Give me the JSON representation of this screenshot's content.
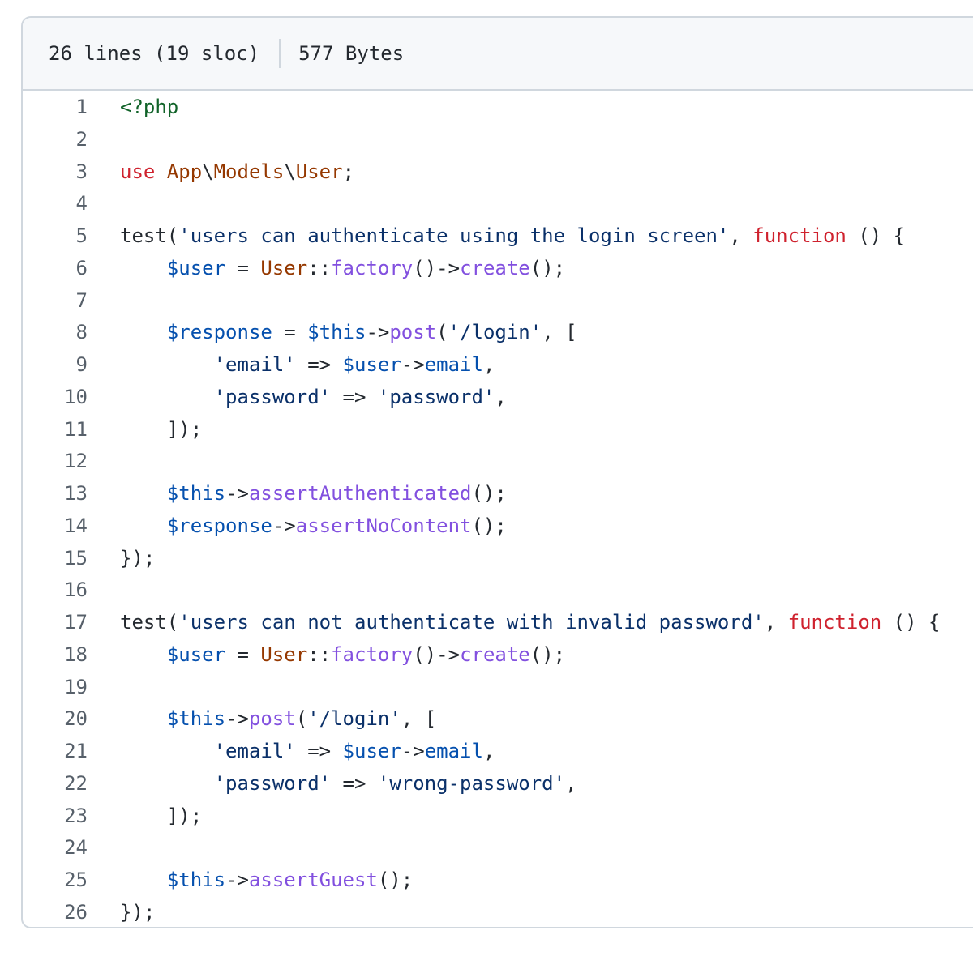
{
  "file_info": {
    "lines": "26 lines (19 sloc)",
    "size": "577 Bytes"
  },
  "colors": {
    "preprocessor": "#116329",
    "keyword": "#cf222e",
    "class": "#953800",
    "string": "#0a3069",
    "variable": "#0550ae",
    "function": "#8250df",
    "plain": "#24292f",
    "line_number": "#57606a"
  },
  "code_lines": [
    {
      "num": "1",
      "tokens": [
        [
          "prep",
          "<?php"
        ]
      ]
    },
    {
      "num": "2",
      "tokens": []
    },
    {
      "num": "3",
      "tokens": [
        [
          "kw",
          "use "
        ],
        [
          "class",
          "App"
        ],
        [
          "plain",
          "\\"
        ],
        [
          "class",
          "Models"
        ],
        [
          "plain",
          "\\"
        ],
        [
          "class",
          "User"
        ],
        [
          "plain",
          ";"
        ]
      ]
    },
    {
      "num": "4",
      "tokens": []
    },
    {
      "num": "5",
      "tokens": [
        [
          "plain",
          "test("
        ],
        [
          "str",
          "'users can authenticate using the login screen'"
        ],
        [
          "plain",
          ", "
        ],
        [
          "kw",
          "function"
        ],
        [
          "plain",
          " () {"
        ]
      ]
    },
    {
      "num": "6",
      "tokens": [
        [
          "plain",
          "    "
        ],
        [
          "var",
          "$user"
        ],
        [
          "plain",
          " = "
        ],
        [
          "class",
          "User"
        ],
        [
          "plain",
          "::"
        ],
        [
          "fn",
          "factory"
        ],
        [
          "plain",
          "()->"
        ],
        [
          "fn",
          "create"
        ],
        [
          "plain",
          "();"
        ]
      ]
    },
    {
      "num": "7",
      "tokens": []
    },
    {
      "num": "8",
      "tokens": [
        [
          "plain",
          "    "
        ],
        [
          "var",
          "$response"
        ],
        [
          "plain",
          " = "
        ],
        [
          "var",
          "$this"
        ],
        [
          "plain",
          "->"
        ],
        [
          "fn",
          "post"
        ],
        [
          "plain",
          "("
        ],
        [
          "str",
          "'/login'"
        ],
        [
          "plain",
          ", ["
        ]
      ]
    },
    {
      "num": "9",
      "tokens": [
        [
          "plain",
          "        "
        ],
        [
          "str",
          "'email'"
        ],
        [
          "plain",
          " => "
        ],
        [
          "var",
          "$user"
        ],
        [
          "plain",
          "->"
        ],
        [
          "prop",
          "email"
        ],
        [
          "plain",
          ","
        ]
      ]
    },
    {
      "num": "10",
      "tokens": [
        [
          "plain",
          "        "
        ],
        [
          "str",
          "'password'"
        ],
        [
          "plain",
          " => "
        ],
        [
          "str",
          "'password'"
        ],
        [
          "plain",
          ","
        ]
      ]
    },
    {
      "num": "11",
      "tokens": [
        [
          "plain",
          "    ]);"
        ]
      ]
    },
    {
      "num": "12",
      "tokens": []
    },
    {
      "num": "13",
      "tokens": [
        [
          "plain",
          "    "
        ],
        [
          "var",
          "$this"
        ],
        [
          "plain",
          "->"
        ],
        [
          "fn",
          "assertAuthenticated"
        ],
        [
          "plain",
          "();"
        ]
      ]
    },
    {
      "num": "14",
      "tokens": [
        [
          "plain",
          "    "
        ],
        [
          "var",
          "$response"
        ],
        [
          "plain",
          "->"
        ],
        [
          "fn",
          "assertNoContent"
        ],
        [
          "plain",
          "();"
        ]
      ]
    },
    {
      "num": "15",
      "tokens": [
        [
          "plain",
          "});"
        ]
      ]
    },
    {
      "num": "16",
      "tokens": []
    },
    {
      "num": "17",
      "tokens": [
        [
          "plain",
          "test("
        ],
        [
          "str",
          "'users can not authenticate with invalid password'"
        ],
        [
          "plain",
          ", "
        ],
        [
          "kw",
          "function"
        ],
        [
          "plain",
          " () {"
        ]
      ]
    },
    {
      "num": "18",
      "tokens": [
        [
          "plain",
          "    "
        ],
        [
          "var",
          "$user"
        ],
        [
          "plain",
          " = "
        ],
        [
          "class",
          "User"
        ],
        [
          "plain",
          "::"
        ],
        [
          "fn",
          "factory"
        ],
        [
          "plain",
          "()->"
        ],
        [
          "fn",
          "create"
        ],
        [
          "plain",
          "();"
        ]
      ]
    },
    {
      "num": "19",
      "tokens": []
    },
    {
      "num": "20",
      "tokens": [
        [
          "plain",
          "    "
        ],
        [
          "var",
          "$this"
        ],
        [
          "plain",
          "->"
        ],
        [
          "fn",
          "post"
        ],
        [
          "plain",
          "("
        ],
        [
          "str",
          "'/login'"
        ],
        [
          "plain",
          ", ["
        ]
      ]
    },
    {
      "num": "21",
      "tokens": [
        [
          "plain",
          "        "
        ],
        [
          "str",
          "'email'"
        ],
        [
          "plain",
          " => "
        ],
        [
          "var",
          "$user"
        ],
        [
          "plain",
          "->"
        ],
        [
          "prop",
          "email"
        ],
        [
          "plain",
          ","
        ]
      ]
    },
    {
      "num": "22",
      "tokens": [
        [
          "plain",
          "        "
        ],
        [
          "str",
          "'password'"
        ],
        [
          "plain",
          " => "
        ],
        [
          "str",
          "'wrong-password'"
        ],
        [
          "plain",
          ","
        ]
      ]
    },
    {
      "num": "23",
      "tokens": [
        [
          "plain",
          "    ]);"
        ]
      ]
    },
    {
      "num": "24",
      "tokens": []
    },
    {
      "num": "25",
      "tokens": [
        [
          "plain",
          "    "
        ],
        [
          "var",
          "$this"
        ],
        [
          "plain",
          "->"
        ],
        [
          "fn",
          "assertGuest"
        ],
        [
          "plain",
          "();"
        ]
      ]
    },
    {
      "num": "26",
      "tokens": [
        [
          "plain",
          "});"
        ]
      ]
    }
  ]
}
